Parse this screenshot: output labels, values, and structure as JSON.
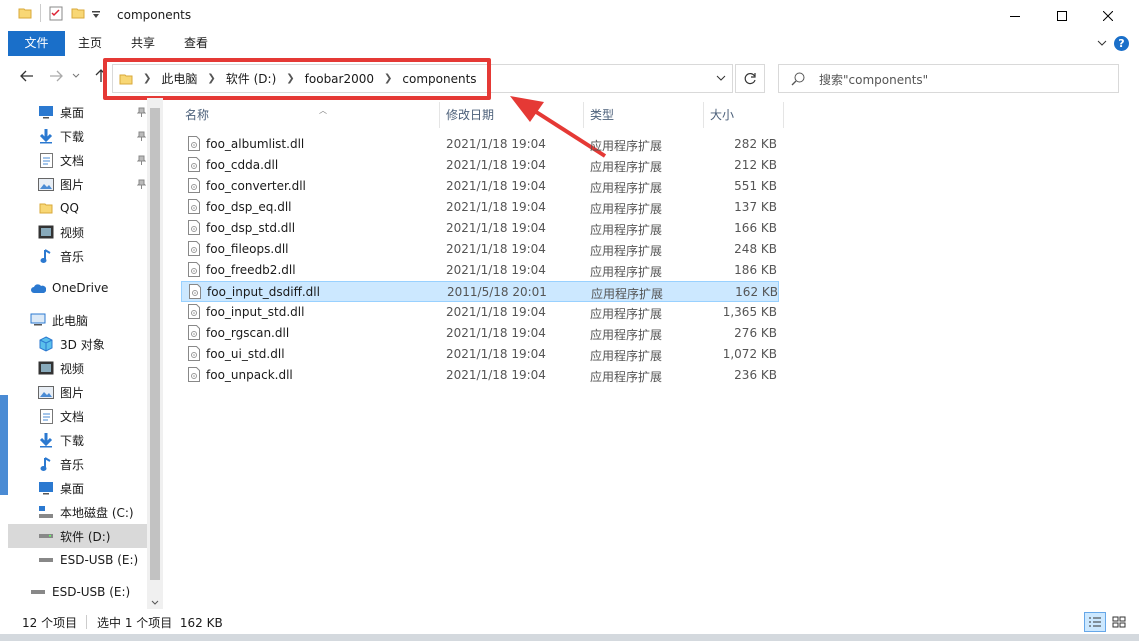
{
  "window": {
    "title": "components",
    "controls": {
      "minimize": "minimize-icon",
      "maximize": "maximize-icon",
      "close": "close-icon"
    }
  },
  "ribbon": {
    "tabs": [
      "文件",
      "主页",
      "共享",
      "查看"
    ],
    "help": "?"
  },
  "address": {
    "breadcrumbs": [
      "此电脑",
      "软件 (D:)",
      "foobar2000",
      "components"
    ]
  },
  "search": {
    "placeholder": "搜索\"components\""
  },
  "columns": {
    "name": "名称",
    "date": "修改日期",
    "type": "类型",
    "size": "大小"
  },
  "nav": {
    "quick_access": [
      {
        "label": "桌面",
        "icon": "desktop-icon",
        "pinned": true
      },
      {
        "label": "下载",
        "icon": "download-icon",
        "pinned": true
      },
      {
        "label": "文档",
        "icon": "document-icon",
        "pinned": true
      },
      {
        "label": "图片",
        "icon": "picture-icon",
        "pinned": true
      },
      {
        "label": "QQ",
        "icon": "folder-icon",
        "pinned": false
      },
      {
        "label": "视频",
        "icon": "video-icon",
        "pinned": false
      },
      {
        "label": "音乐",
        "icon": "music-icon",
        "pinned": false
      }
    ],
    "onedrive": "OneDrive",
    "this_pc": "此电脑",
    "pc_items": [
      {
        "label": "3D 对象",
        "icon": "3d-objects-icon"
      },
      {
        "label": "视频",
        "icon": "video-icon"
      },
      {
        "label": "图片",
        "icon": "picture-icon"
      },
      {
        "label": "文档",
        "icon": "document-icon"
      },
      {
        "label": "下载",
        "icon": "download-icon"
      },
      {
        "label": "音乐",
        "icon": "music-icon"
      },
      {
        "label": "桌面",
        "icon": "desktop-icon"
      },
      {
        "label": "本地磁盘 (C:)",
        "icon": "system-drive-icon"
      },
      {
        "label": "软件 (D:)",
        "icon": "drive-icon",
        "selected": true
      },
      {
        "label": "ESD-USB (E:)",
        "icon": "drive-icon"
      }
    ],
    "extra": {
      "label": "ESD-USB (E:)",
      "icon": "drive-icon"
    }
  },
  "files": [
    {
      "name": "foo_albumlist.dll",
      "date": "2021/1/18 19:04",
      "type": "应用程序扩展",
      "size": "282 KB"
    },
    {
      "name": "foo_cdda.dll",
      "date": "2021/1/18 19:04",
      "type": "应用程序扩展",
      "size": "212 KB"
    },
    {
      "name": "foo_converter.dll",
      "date": "2021/1/18 19:04",
      "type": "应用程序扩展",
      "size": "551 KB"
    },
    {
      "name": "foo_dsp_eq.dll",
      "date": "2021/1/18 19:04",
      "type": "应用程序扩展",
      "size": "137 KB"
    },
    {
      "name": "foo_dsp_std.dll",
      "date": "2021/1/18 19:04",
      "type": "应用程序扩展",
      "size": "166 KB"
    },
    {
      "name": "foo_fileops.dll",
      "date": "2021/1/18 19:04",
      "type": "应用程序扩展",
      "size": "248 KB"
    },
    {
      "name": "foo_freedb2.dll",
      "date": "2021/1/18 19:04",
      "type": "应用程序扩展",
      "size": "186 KB"
    },
    {
      "name": "foo_input_dsdiff.dll",
      "date": "2011/5/18 20:01",
      "type": "应用程序扩展",
      "size": "162 KB",
      "selected": true
    },
    {
      "name": "foo_input_std.dll",
      "date": "2021/1/18 19:04",
      "type": "应用程序扩展",
      "size": "1,365 KB"
    },
    {
      "name": "foo_rgscan.dll",
      "date": "2021/1/18 19:04",
      "type": "应用程序扩展",
      "size": "276 KB"
    },
    {
      "name": "foo_ui_std.dll",
      "date": "2021/1/18 19:04",
      "type": "应用程序扩展",
      "size": "1,072 KB"
    },
    {
      "name": "foo_unpack.dll",
      "date": "2021/1/18 19:04",
      "type": "应用程序扩展",
      "size": "236 KB"
    }
  ],
  "status": {
    "item_count": "12 个项目",
    "selection": "选中 1 个项目  162 KB"
  },
  "colors": {
    "accent": "#1a6fc9",
    "selection": "#cce8ff",
    "annotation": "#e53935"
  }
}
